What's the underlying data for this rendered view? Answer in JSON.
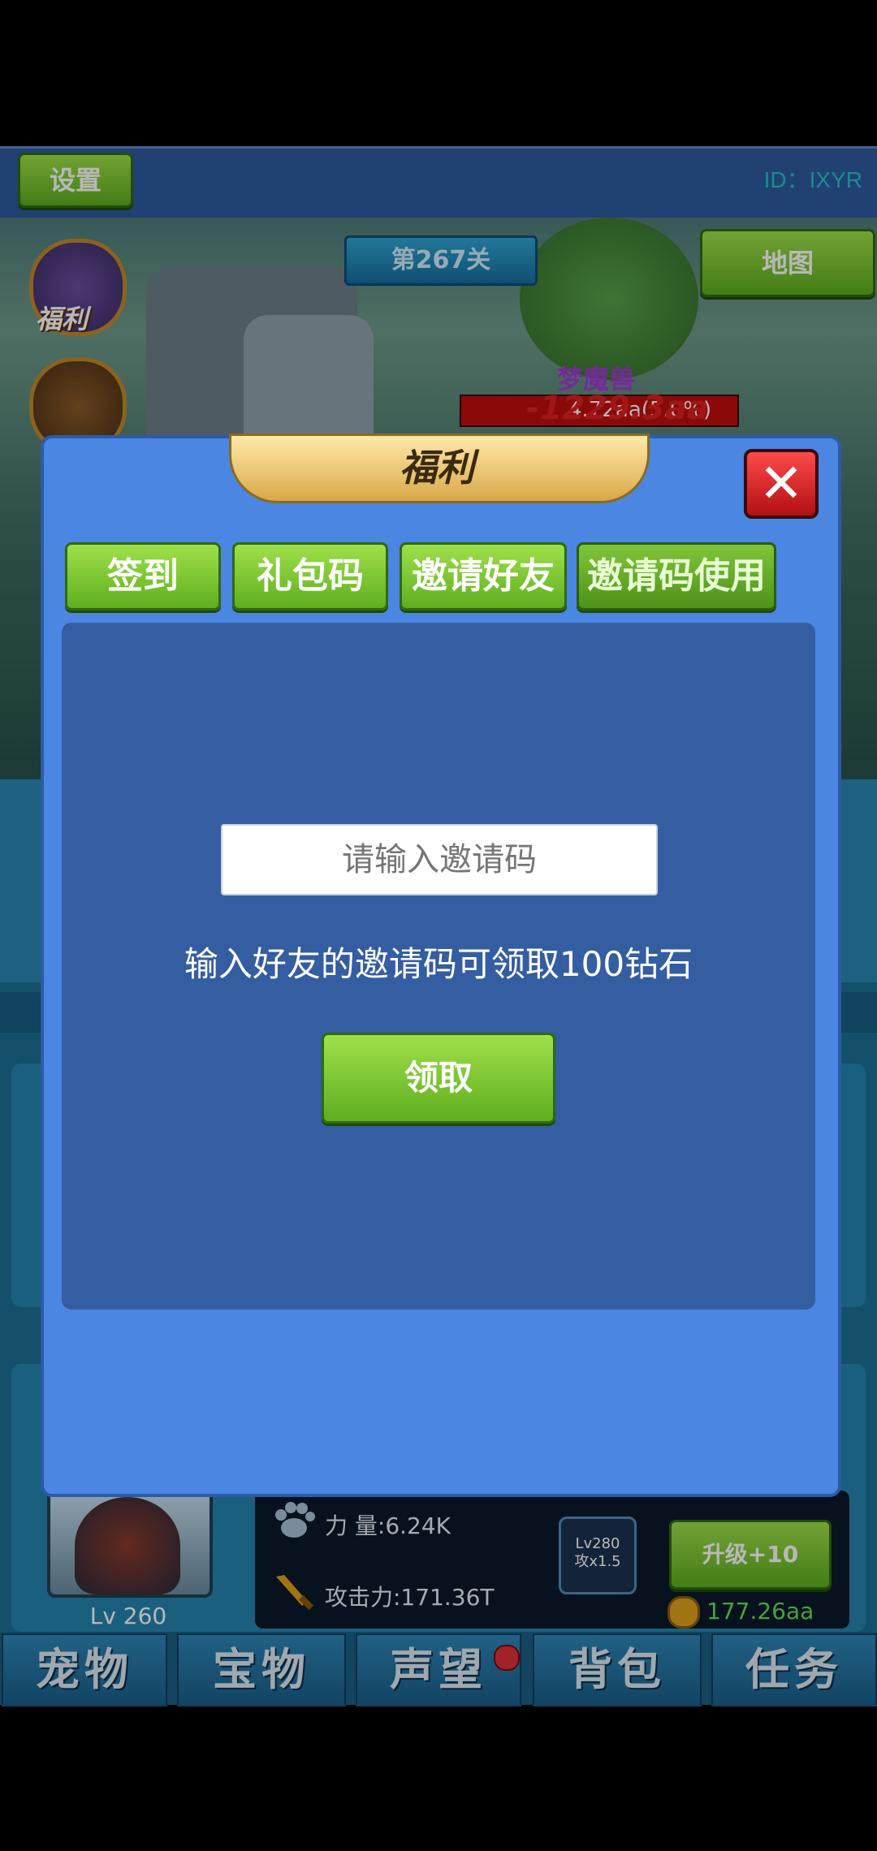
{
  "top_bar": {
    "settings_label": "设置",
    "player_id": "ID：IXYR"
  },
  "scene": {
    "stage_label": "第267关",
    "map_label": "地图",
    "fuli_icon_label": "福利",
    "boss_name": "梦魔兽",
    "boss_hp_text": "4.72aa(5.0%)",
    "damage_float": "-1229.3aa"
  },
  "modal": {
    "title": "福利",
    "close_label": "✕",
    "tabs": [
      {
        "label": "签到"
      },
      {
        "label": "礼包码"
      },
      {
        "label": "邀请好友"
      },
      {
        "label": "邀请码使用",
        "active": true
      }
    ],
    "invite_placeholder": "请输入邀请码",
    "invite_value": "",
    "hint": "输入好友的邀请码可领取100钻石",
    "claim_label": "领取"
  },
  "pet_card": {
    "level": "Lv 260",
    "power": "力  量:6.24K",
    "attack": "攻击力:171.36T",
    "skill_badge": {
      "line1": "Lv280",
      "line2": "攻x1.5"
    },
    "upgrade_label": "升级+10",
    "gold": "177.26aa"
  },
  "bottom_nav": [
    {
      "label": "宠物"
    },
    {
      "label": "宝物"
    },
    {
      "label": "声望",
      "badge": true
    },
    {
      "label": "背包"
    },
    {
      "label": "任务"
    }
  ]
}
